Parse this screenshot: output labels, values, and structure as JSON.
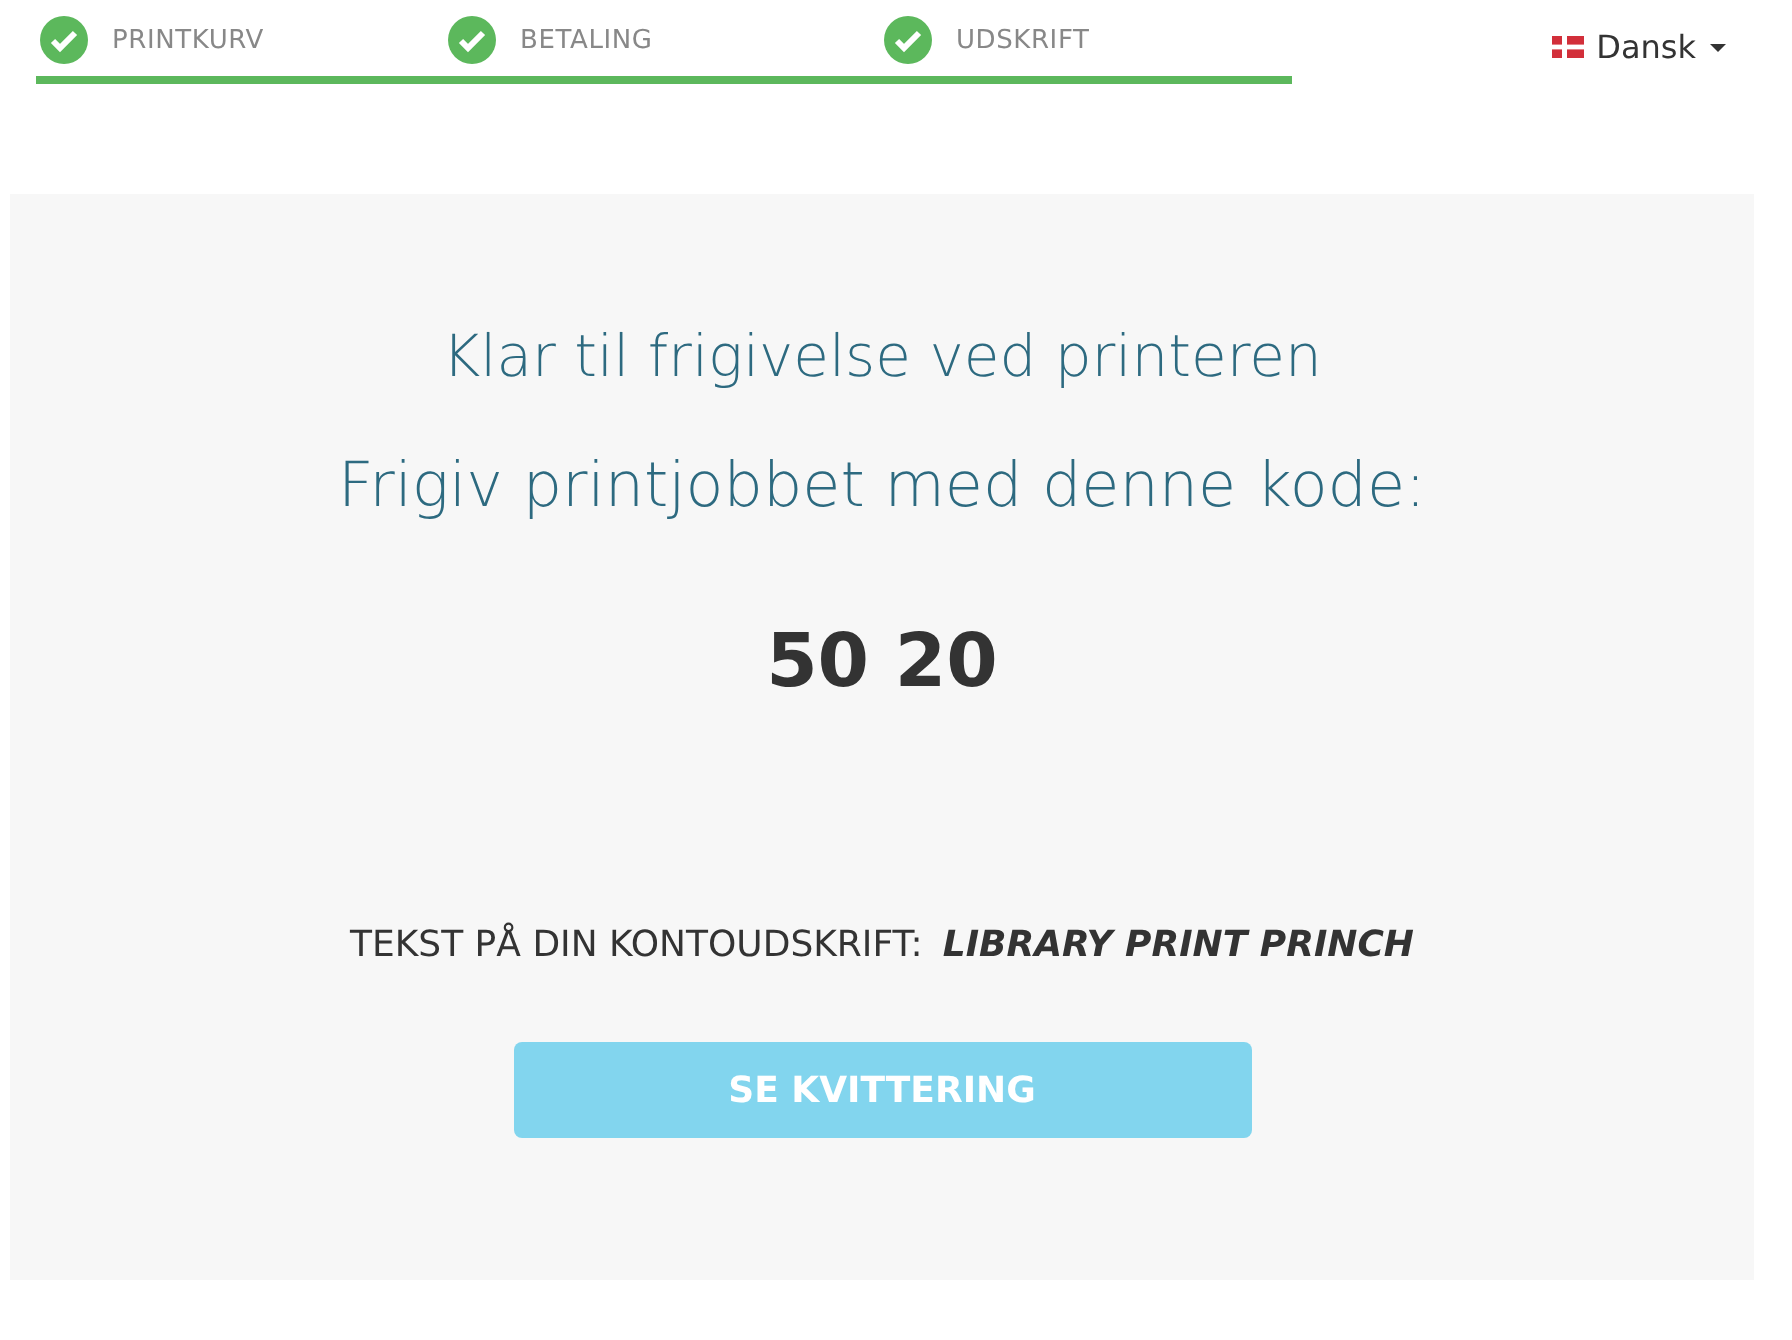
{
  "steps": [
    {
      "label": "PRINTKURV",
      "done": true
    },
    {
      "label": "BETALING",
      "done": true
    },
    {
      "label": "UDSKRIFT",
      "done": true
    }
  ],
  "language": {
    "label": "Dansk"
  },
  "panel": {
    "title": "Klar til frigivelse ved printeren",
    "subtitle": "Frigiv printjobbet med denne kode:",
    "code": "50 20",
    "statement_label": "TEKST PÅ DIN KONTOUDSKRIFT:",
    "statement_value": "LIBRARY PRINT PRINCH",
    "button": "SE KVITTERING"
  }
}
